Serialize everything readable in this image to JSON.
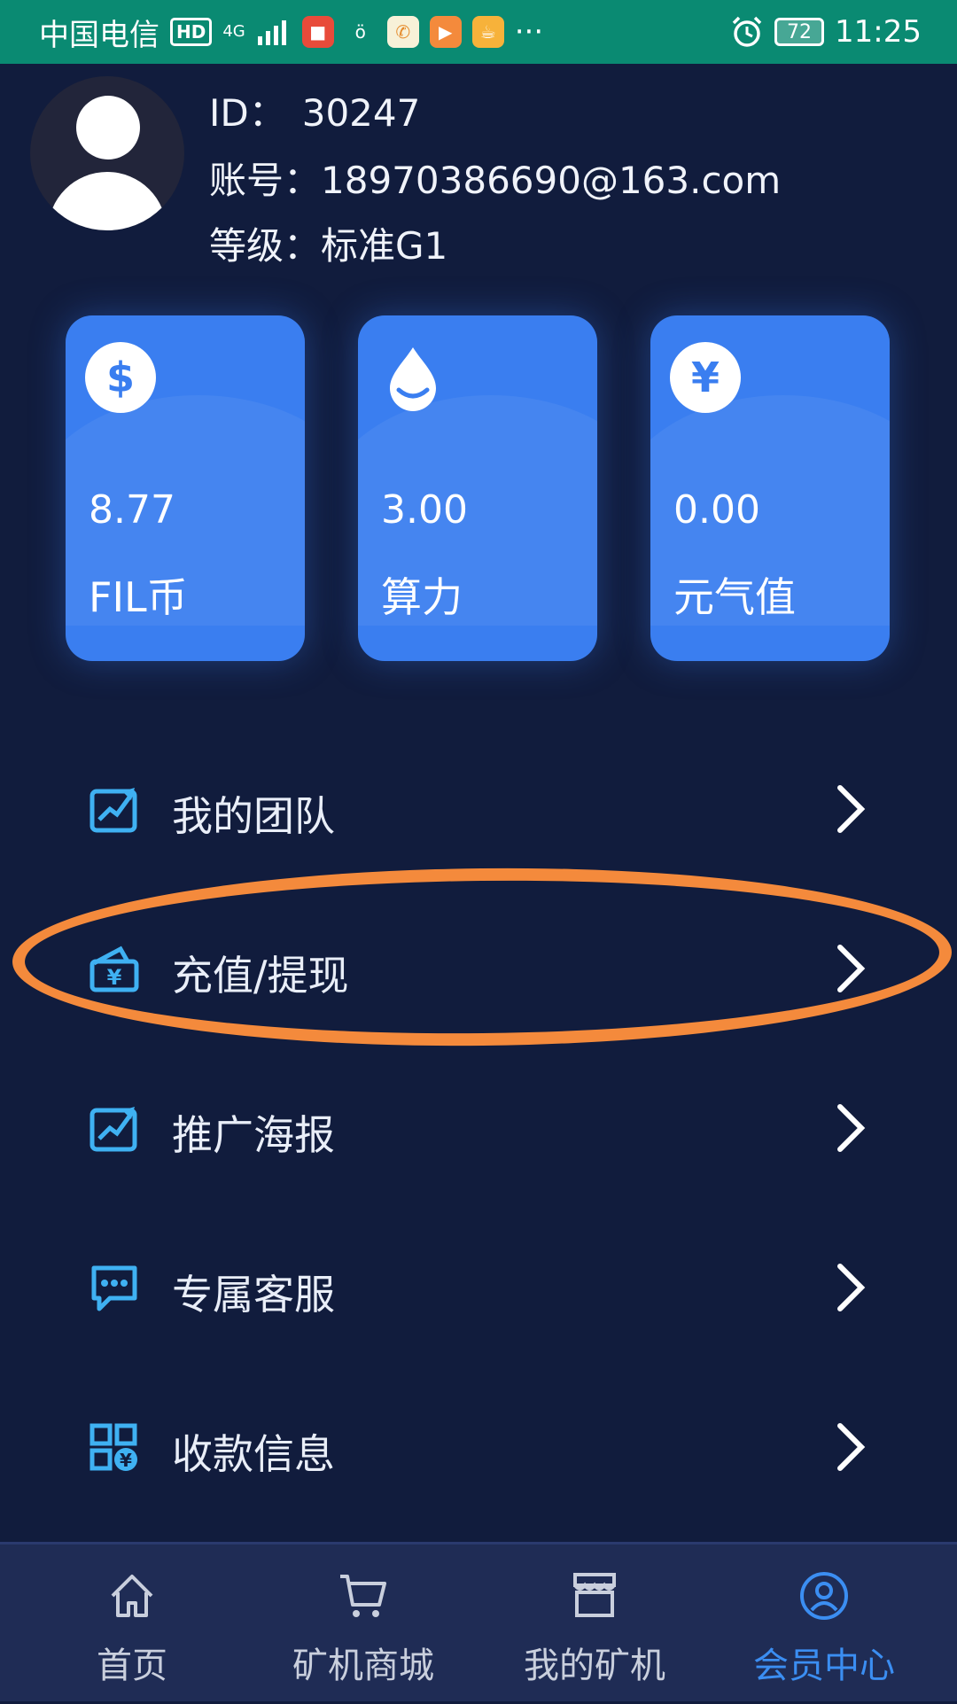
{
  "status_bar": {
    "carrier": "中国电信",
    "hd": "HD",
    "network": "4G",
    "battery": "72",
    "time": "11:25",
    "more": "···"
  },
  "profile": {
    "id_label": "ID：",
    "id_value": "30247",
    "account_label": "账号：",
    "account_value": "18970386690@163.com",
    "level_label": "等级：",
    "level_value": "标准G1"
  },
  "cards": [
    {
      "icon": "dollar-icon",
      "glyph": "$",
      "value": "8.77",
      "name": "FIL币"
    },
    {
      "icon": "water-drop-icon",
      "glyph": "",
      "value": "3.00",
      "name": "算力"
    },
    {
      "icon": "yen-icon",
      "glyph": "¥",
      "value": "0.00",
      "name": "元气值"
    }
  ],
  "menu": {
    "items": [
      {
        "label": "我的团队",
        "icon": "trend-chart-icon"
      },
      {
        "label": "充值/提现",
        "icon": "wallet-yen-icon"
      },
      {
        "label": "推广海报",
        "icon": "trend-chart-icon"
      },
      {
        "label": "专属客服",
        "icon": "chat-bubble-icon"
      },
      {
        "label": "收款信息",
        "icon": "qr-yen-icon"
      }
    ]
  },
  "tabs": [
    {
      "label": "首页",
      "icon": "home-icon",
      "active": false
    },
    {
      "label": "矿机商城",
      "icon": "cart-icon",
      "active": false
    },
    {
      "label": "我的矿机",
      "icon": "store-icon",
      "active": false
    },
    {
      "label": "会员中心",
      "icon": "user-circle-icon",
      "active": true
    }
  ],
  "colors": {
    "background": "#111c3d",
    "status_bar": "#0a8a72",
    "card": "#3a7ef0",
    "accent": "#3b8ef2",
    "highlight": "#f48a3c",
    "tabbar": "#1f2c55"
  }
}
